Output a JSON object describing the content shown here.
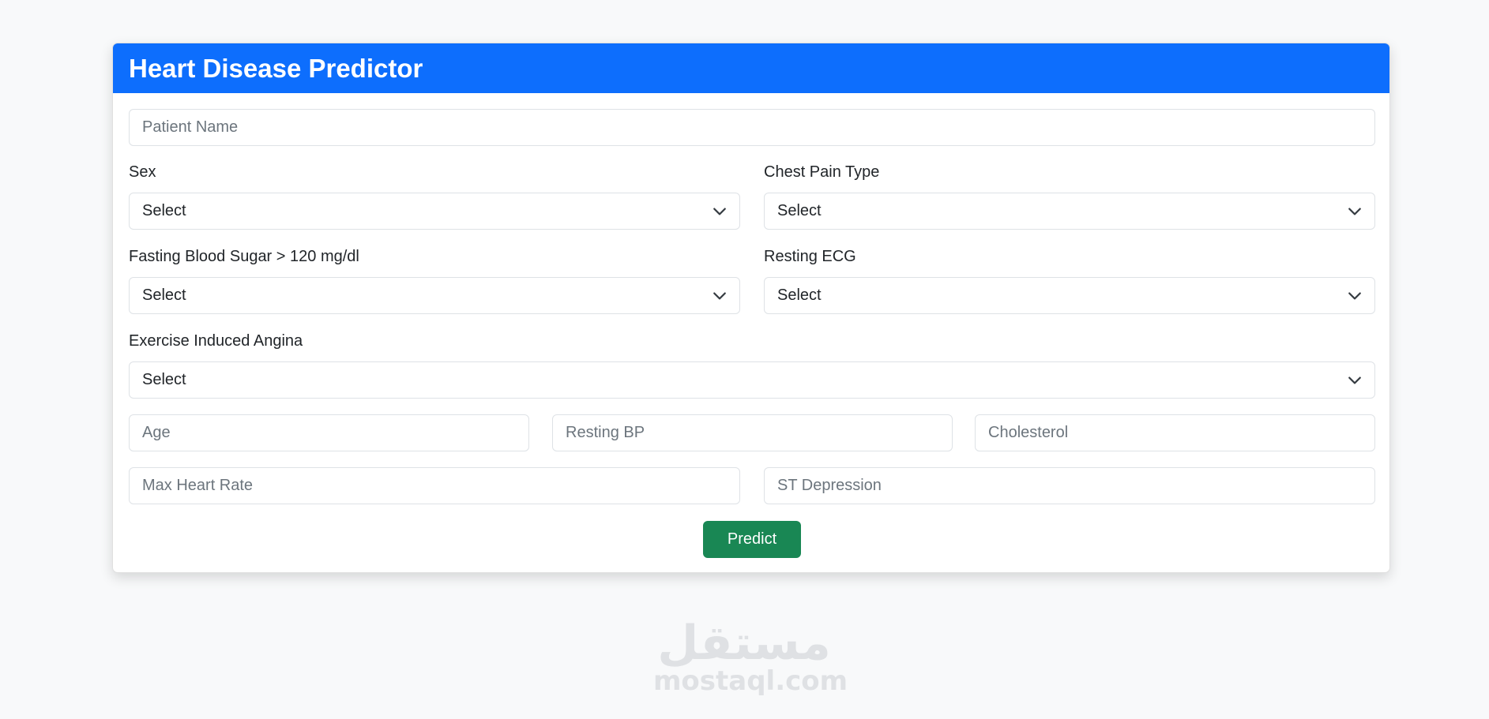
{
  "header": {
    "title": "Heart Disease Predictor"
  },
  "form": {
    "patient_name": {
      "placeholder": "Patient Name"
    },
    "sex": {
      "label": "Sex",
      "value": "Select"
    },
    "chest_pain_type": {
      "label": "Chest Pain Type",
      "value": "Select"
    },
    "fasting_blood_sugar": {
      "label": "Fasting Blood Sugar > 120 mg/dl",
      "value": "Select"
    },
    "resting_ecg": {
      "label": "Resting ECG",
      "value": "Select"
    },
    "exercise_induced_angina": {
      "label": "Exercise Induced Angina",
      "value": "Select"
    },
    "age": {
      "placeholder": "Age"
    },
    "resting_bp": {
      "placeholder": "Resting BP"
    },
    "cholesterol": {
      "placeholder": "Cholesterol"
    },
    "max_heart_rate": {
      "placeholder": "Max Heart Rate"
    },
    "st_depression": {
      "placeholder": "ST Depression"
    },
    "predict_label": "Predict"
  },
  "watermark": {
    "arabic": "مستقل",
    "latin": "mostaql.com"
  },
  "colors": {
    "header": "#0d6efd",
    "predict_button": "#198754",
    "background": "#f8f9fa",
    "border": "#dee2e6"
  }
}
